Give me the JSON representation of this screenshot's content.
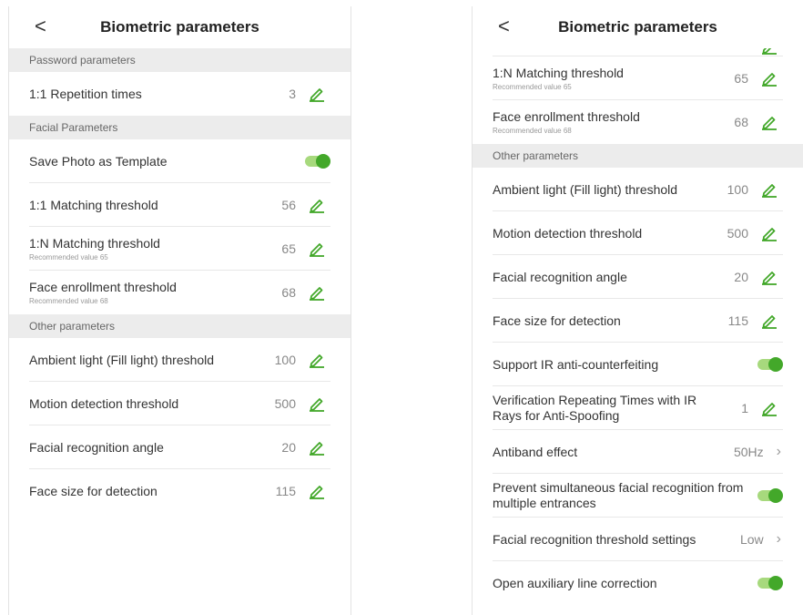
{
  "left": {
    "title": "Biometric parameters",
    "back": "<",
    "sections": {
      "password": "Password parameters",
      "facial": "Facial Parameters",
      "other": "Other parameters"
    },
    "rows": {
      "repetition": {
        "label": "1:1 Repetition times",
        "value": "3"
      },
      "save_photo": {
        "label": "Save Photo as Template"
      },
      "match11": {
        "label": "1:1 Matching threshold",
        "value": "56"
      },
      "match1n": {
        "label": "1:N Matching threshold",
        "sub": "Recommended value  65",
        "value": "65"
      },
      "enroll": {
        "label": "Face enrollment threshold",
        "sub": "Recommended value  68",
        "value": "68"
      },
      "ambient": {
        "label": "Ambient light (Fill light) threshold",
        "value": "100"
      },
      "motion": {
        "label": "Motion detection threshold",
        "value": "500"
      },
      "angle": {
        "label": "Facial recognition angle",
        "value": "20"
      },
      "face_size": {
        "label": "Face size for detection",
        "value": "115"
      }
    }
  },
  "right": {
    "title": "Biometric parameters",
    "back": "<",
    "sections": {
      "other": "Other parameters"
    },
    "rows": {
      "match1n": {
        "label": "1:N Matching threshold",
        "sub": "Recommended value  65",
        "value": "65"
      },
      "enroll": {
        "label": "Face enrollment threshold",
        "sub": "Recommended value  68",
        "value": "68"
      },
      "ambient": {
        "label": "Ambient light (Fill light) threshold",
        "value": "100"
      },
      "motion": {
        "label": "Motion detection threshold",
        "value": "500"
      },
      "angle": {
        "label": "Facial recognition angle",
        "value": "20"
      },
      "face_size": {
        "label": "Face size for detection",
        "value": "115"
      },
      "ir_anti": {
        "label": "Support IR anti-counterfeiting"
      },
      "ir_repeat": {
        "label": "Verification Repeating Times with IR Rays for Anti-Spoofing",
        "value": "1"
      },
      "antiband": {
        "label": "Antiband effect",
        "value": "50Hz"
      },
      "prevent_multi": {
        "label": "Prevent simultaneous facial recognition from multiple entrances"
      },
      "threshold_settings": {
        "label": "Facial recognition threshold settings",
        "value": "Low"
      },
      "aux_line": {
        "label": "Open auxiliary line correction"
      }
    }
  },
  "colors": {
    "accent": "#43a82a",
    "toggle_track": "#a7d97d",
    "section_bg": "#ececec"
  },
  "icons": {
    "edit": "pencil-icon",
    "back": "chevron-left-icon",
    "forward": "chevron-right-icon"
  }
}
